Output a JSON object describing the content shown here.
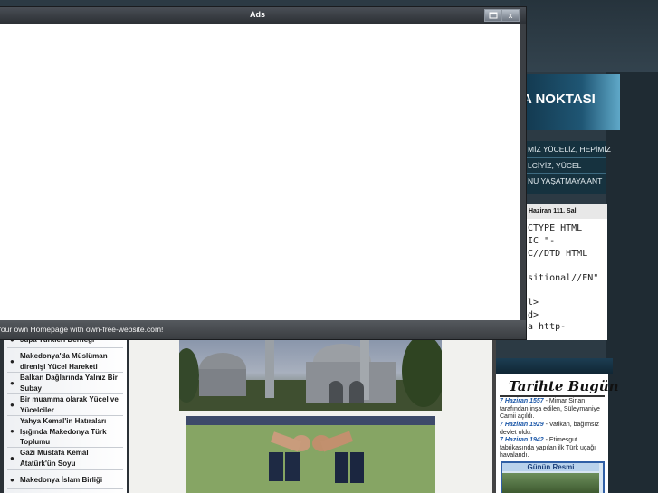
{
  "popup": {
    "title": "Ads",
    "footer_text": "Your own Homepage with own-free-website.com!",
    "buttons": {
      "restore_icon": "restore-icon",
      "close_glyph": "x"
    }
  },
  "site": {
    "header_title": "A NOKTASI",
    "motto": [
      "MİZ YÜCELİZ, HEPİMİZ",
      "LCİYİZ, YÜCEL",
      "NU YAŞATMAYA ANT"
    ],
    "date": "Haziran 111. Salı",
    "code_lines": [
      "CTYPE HTML",
      "IC \"-",
      "C//DTD HTML",
      "sitional//EN\"",
      "l>",
      "d>",
      "a http-"
    ],
    "tarihte_bugun": {
      "title": "Tarihte Bugün",
      "entries": [
        {
          "date": "7 Haziran 1557",
          "text": " - Mimar Sinan tarafından inşa edilen, Süleymaniye Camii açıldı."
        },
        {
          "date": "7 Haziran 1929",
          "text": " - Vatikan, bağımsız devlet oldu."
        },
        {
          "date": "7 Haziran 1942",
          "text": " - Etimesgut fabrikasında yapılan ilk Türk uçağı havalandı."
        }
      ],
      "gunun_resmi": "Günün Resmi"
    },
    "left_nav": [
      {
        "label": "Jupa Türkleri Derneği"
      },
      {
        "label": "Makedonya'da Müslüman direnişi Yücel Hareketi"
      },
      {
        "label": "Balkan Dağlarında Yalnız Bir Subay"
      },
      {
        "label": "Bir muamma olarak Yücel ve Yücelciler"
      },
      {
        "label": "Yahya Kemal'in Hatıraları Işığında Makedonya Türk Toplumu"
      },
      {
        "label": "Gazi Mustafa Kemal Atatürk'ün Soyu"
      },
      {
        "label": "Makedonya İslam Birliği"
      }
    ],
    "colors": {
      "accent": "#1b57a8",
      "popup_chrome": "#3b3f44",
      "banner": "#1f5674"
    }
  }
}
